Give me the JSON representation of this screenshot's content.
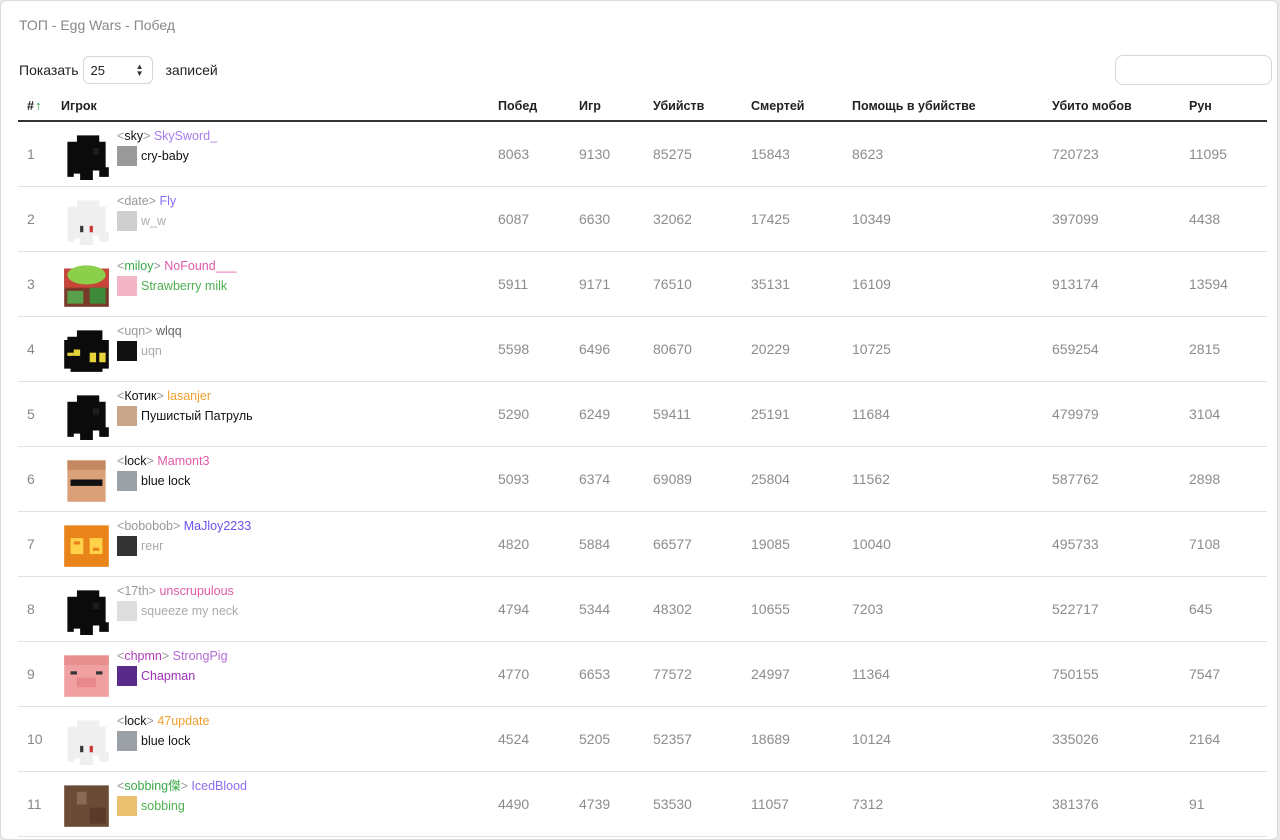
{
  "title": "ТОП - Egg Wars - Побед",
  "controls": {
    "show_label": "Показать",
    "page_size": "25",
    "after_label": "записей",
    "search_placeholder": "",
    "search_value": ""
  },
  "columns": [
    "#",
    "Игрок",
    "Побед",
    "Игр",
    "Убийств",
    "Смертей",
    "Помощь в убийстве",
    "Убито мобов",
    "Рун"
  ],
  "rows": [
    {
      "rank": "1",
      "tag": "sky",
      "tag_color": "#111111",
      "name": "SkySword_",
      "name_color": "#a77ef0",
      "clan": "cry-baby",
      "clan_color": "#111111",
      "head": "dark",
      "mini": "#9a9a9a",
      "wins": "8063",
      "games": "9130",
      "kills": "85275",
      "deaths": "15843",
      "assists": "8623",
      "mobs": "720723",
      "runes": "11095"
    },
    {
      "rank": "2",
      "tag": "date",
      "tag_color": "#999999",
      "name": "Fly",
      "name_color": "#8b6cf0",
      "clan": "w_w",
      "clan_color": "#aaaaaa",
      "head": "white",
      "mini": "#cfcfcf",
      "wins": "6087",
      "games": "6630",
      "kills": "32062",
      "deaths": "17425",
      "assists": "10349",
      "mobs": "397099",
      "runes": "4438"
    },
    {
      "rank": "3",
      "tag": "miloy",
      "tag_color": "#3aa84a",
      "name": "NoFound___",
      "name_color": "#e05aa8",
      "clan": "Strawberry milk",
      "clan_color": "#4caf50",
      "head": "plant",
      "mini": "#f3b6c6",
      "wins": "5911",
      "games": "9171",
      "kills": "76510",
      "deaths": "35131",
      "assists": "16109",
      "mobs": "913174",
      "runes": "13594"
    },
    {
      "rank": "4",
      "tag": "uqn",
      "tag_color": "#999999",
      "name": "wlqq",
      "name_color": "#666666",
      "clan": "uqn",
      "clan_color": "#aaaaaa",
      "head": "blackgold",
      "mini": "#111111",
      "wins": "5598",
      "games": "6496",
      "kills": "80670",
      "deaths": "20229",
      "assists": "10725",
      "mobs": "659254",
      "runes": "2815"
    },
    {
      "rank": "5",
      "tag": "Котик",
      "tag_color": "#111111",
      "name": "lasanjer",
      "name_color": "#f0a030",
      "clan": "Пушистый Патруль",
      "clan_color": "#111111",
      "head": "dark",
      "mini": "#c9a58a",
      "wins": "5290",
      "games": "6249",
      "kills": "59411",
      "deaths": "25191",
      "assists": "11684",
      "mobs": "479979",
      "runes": "3104"
    },
    {
      "rank": "6",
      "tag": "lock",
      "tag_color": "#111111",
      "name": "Mamont3",
      "name_color": "#e05aa8",
      "clan": "blue lock",
      "clan_color": "#111111",
      "head": "skin",
      "mini": "#9aa0a6",
      "wins": "5093",
      "games": "6374",
      "kills": "69089",
      "deaths": "25804",
      "assists": "11562",
      "mobs": "587762",
      "runes": "2898"
    },
    {
      "rank": "7",
      "tag": "bobobob",
      "tag_color": "#999999",
      "name": "MaJloy2233",
      "name_color": "#6d4ff0",
      "clan": "генг",
      "clan_color": "#aaaaaa",
      "head": "pumpkin",
      "mini": "#333333",
      "wins": "4820",
      "games": "5884",
      "kills": "66577",
      "deaths": "19085",
      "assists": "10040",
      "mobs": "495733",
      "runes": "7108"
    },
    {
      "rank": "8",
      "tag": "17th",
      "tag_color": "#999999",
      "name": "unscrupulous",
      "name_color": "#e05aa8",
      "clan": "squeeze my neck",
      "clan_color": "#aaaaaa",
      "head": "dark",
      "mini": "#dddddd",
      "wins": "4794",
      "games": "5344",
      "kills": "48302",
      "deaths": "10655",
      "assists": "7203",
      "mobs": "522717",
      "runes": "645"
    },
    {
      "rank": "9",
      "tag": "chpmn",
      "tag_color": "#b03ab8",
      "name": "StrongPig",
      "name_color": "#b56ad8",
      "clan": "Chapman",
      "clan_color": "#9b30b8",
      "head": "pig",
      "mini": "#5a2a8a",
      "wins": "4770",
      "games": "6653",
      "kills": "77572",
      "deaths": "24997",
      "assists": "11364",
      "mobs": "750155",
      "runes": "7547"
    },
    {
      "rank": "10",
      "tag": "lock",
      "tag_color": "#111111",
      "name": "47update",
      "name_color": "#f0a030",
      "clan": "blue lock",
      "clan_color": "#111111",
      "head": "white",
      "mini": "#9aa0a6",
      "wins": "4524",
      "games": "5205",
      "kills": "52357",
      "deaths": "18689",
      "assists": "10124",
      "mobs": "335026",
      "runes": "2164"
    },
    {
      "rank": "11",
      "tag": "sobbing傑",
      "tag_color": "#3aa84a",
      "name": "IcedBlood",
      "name_color": "#8b6cf0",
      "clan": "sobbing",
      "clan_color": "#4caf50",
      "head": "brown",
      "mini": "#e8c070",
      "wins": "4490",
      "games": "4739",
      "kills": "53530",
      "deaths": "11057",
      "assists": "7312",
      "mobs": "381376",
      "runes": "91"
    }
  ]
}
